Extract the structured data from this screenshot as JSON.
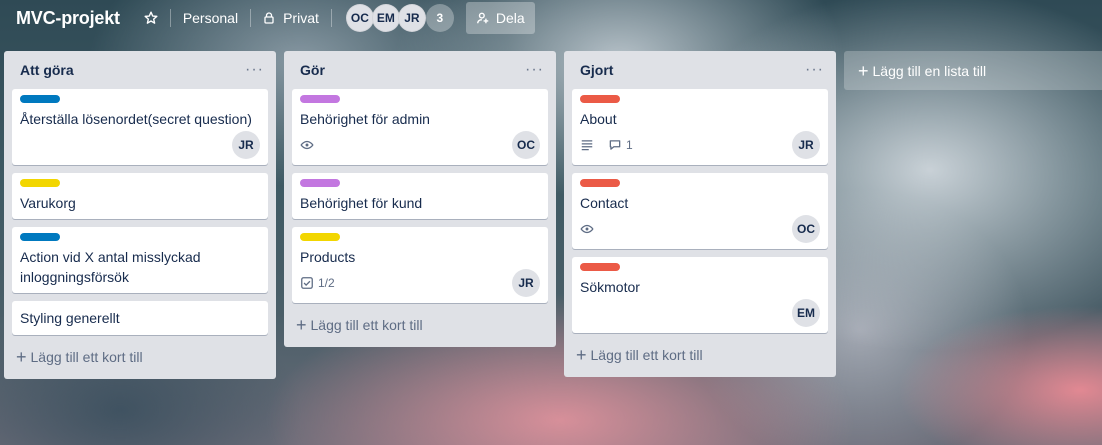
{
  "header": {
    "board_title": "MVC-projekt",
    "team_label": "Personal",
    "visibility_label": "Privat",
    "members": [
      "OC",
      "EM",
      "JR"
    ],
    "member_count": "3",
    "share_label": "Dela"
  },
  "lists": [
    {
      "title": "Att göra",
      "add_card": "Lägg till ett kort till",
      "cards": [
        {
          "label_color": "#0079bf",
          "title": "Återställa lösenordet(secret question)",
          "avatar": "JR"
        },
        {
          "label_color": "#f2d600",
          "title": "Varukorg"
        },
        {
          "label_color": "#0079bf",
          "title": "Action vid X antal misslyckad inloggningsförsök"
        },
        {
          "title": "Styling generellt"
        }
      ]
    },
    {
      "title": "Gör",
      "add_card": "Lägg till ett kort till",
      "cards": [
        {
          "label_color": "#c377e0",
          "title": "Behörighet för admin",
          "badges": [
            "eye-icon"
          ],
          "avatar": "OC"
        },
        {
          "label_color": "#c377e0",
          "title": "Behörighet för kund"
        },
        {
          "label_color": "#f2d600",
          "title": "Products",
          "checklist": "1/2",
          "avatar": "JR"
        }
      ]
    },
    {
      "title": "Gjort",
      "add_card": "Lägg till ett kort till",
      "cards": [
        {
          "label_color": "#eb5a46",
          "title": "About",
          "badges": [
            "description-icon",
            "comment-icon"
          ],
          "comments": "1",
          "avatar": "JR"
        },
        {
          "label_color": "#eb5a46",
          "title": "Contact",
          "badges": [
            "eye-icon"
          ],
          "avatar": "OC"
        },
        {
          "label_color": "#eb5a46",
          "title": "Sökmotor",
          "avatar": "EM"
        }
      ]
    }
  ],
  "add_list": "Lägg till en lista till",
  "list_menu_glyph": "···",
  "add_glyph": "+"
}
